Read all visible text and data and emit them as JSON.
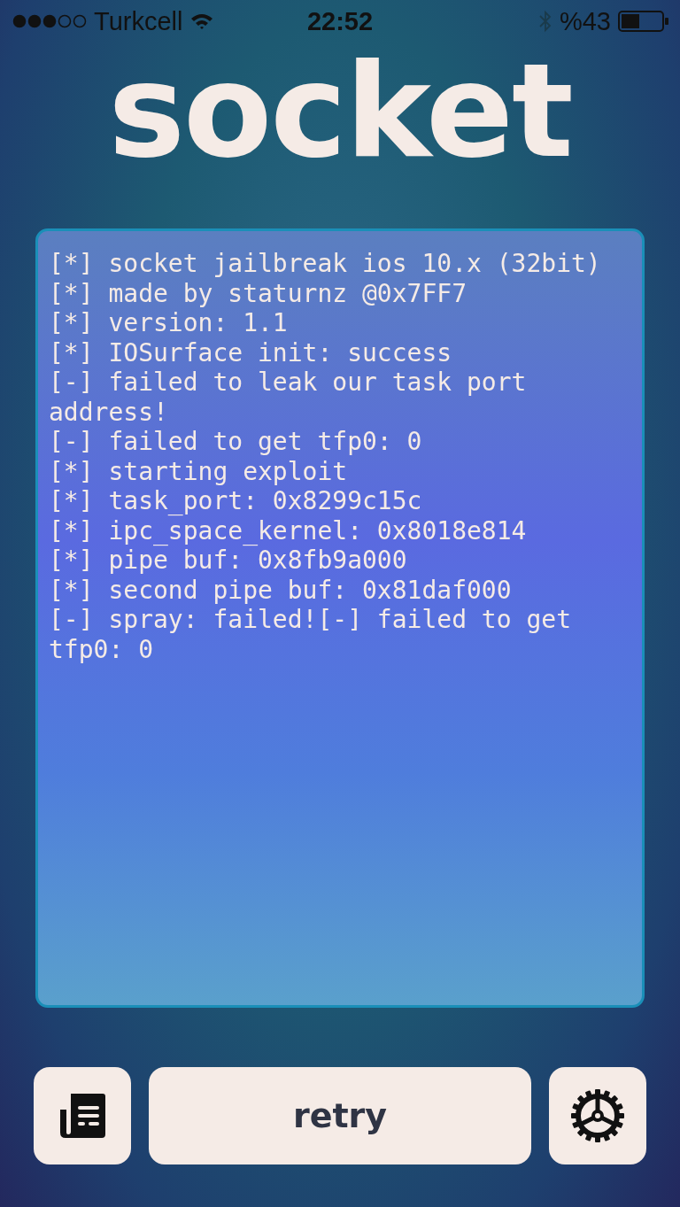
{
  "status_bar": {
    "carrier": "Turkcell",
    "time": "22:52",
    "battery": "%43"
  },
  "title": "socket",
  "log": [
    "[*] socket jailbreak ios 10.x (32bit)",
    "[*] made by staturnz @0x7FF7",
    "[*] version: 1.1",
    "[*] IOSurface init: success",
    "[-] failed to leak our task port address!",
    "[-] failed to get tfp0: 0",
    "[*] starting exploit",
    "[*] task_port: 0x8299c15c",
    "[*] ipc_space_kernel: 0x8018e814",
    "[*] pipe buf: 0x8fb9a000",
    "[*] second pipe buf: 0x81daf000",
    "[-] spray: failed![-] failed to get tfp0: 0"
  ],
  "buttons": {
    "retry": "retry"
  }
}
